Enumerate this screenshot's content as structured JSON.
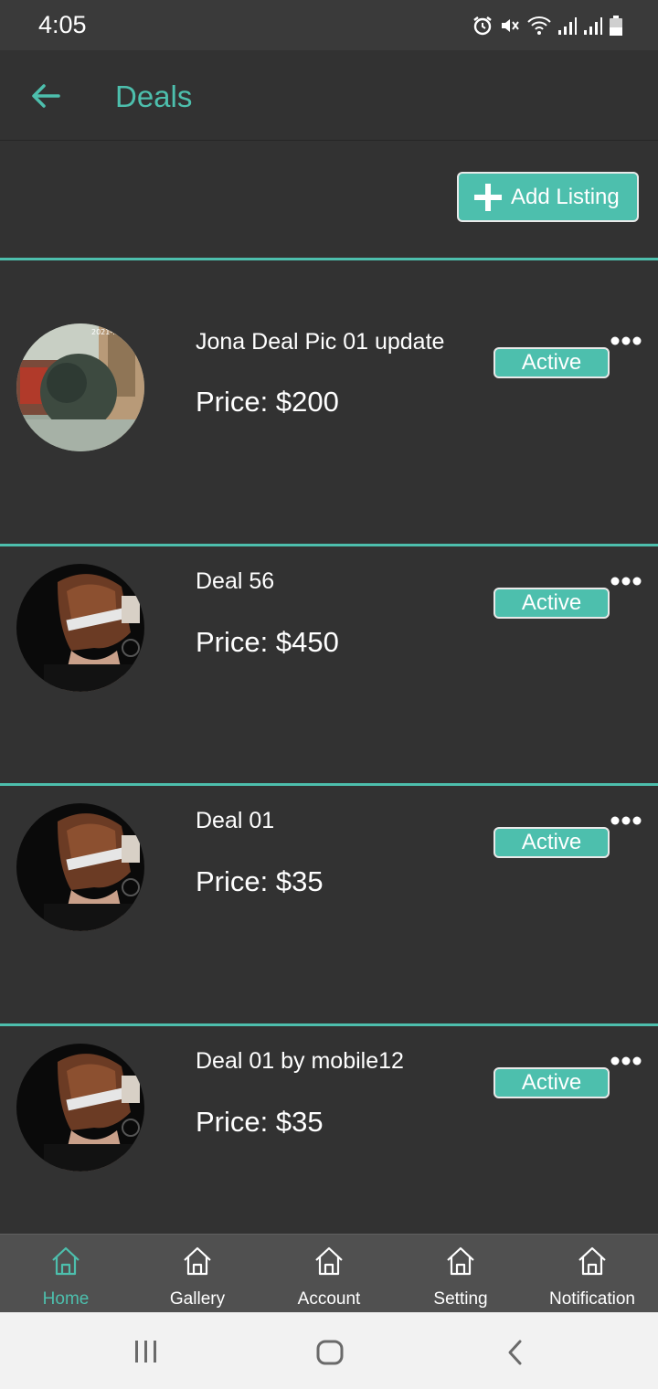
{
  "status_bar": {
    "time": "4:05"
  },
  "header": {
    "title": "Deals"
  },
  "toolbar": {
    "add_label": "Add Listing"
  },
  "deals": [
    {
      "name": "Jona Deal Pic 01 update",
      "price": "Price: $200",
      "status": "Active"
    },
    {
      "name": "Deal 56",
      "price": "Price: $450",
      "status": "Active"
    },
    {
      "name": "Deal 01",
      "price": "Price: $35",
      "status": "Active"
    },
    {
      "name": "Deal 01 by mobile12",
      "price": "Price: $35",
      "status": "Active"
    }
  ],
  "bottom_nav": [
    {
      "label": "Home",
      "active": true
    },
    {
      "label": "Gallery",
      "active": false
    },
    {
      "label": "Account",
      "active": false
    },
    {
      "label": "Setting",
      "active": false
    },
    {
      "label": "Notification",
      "active": false
    }
  ],
  "colors": {
    "accent": "#4dbfad",
    "background": "#323232",
    "nav": "#505050"
  }
}
